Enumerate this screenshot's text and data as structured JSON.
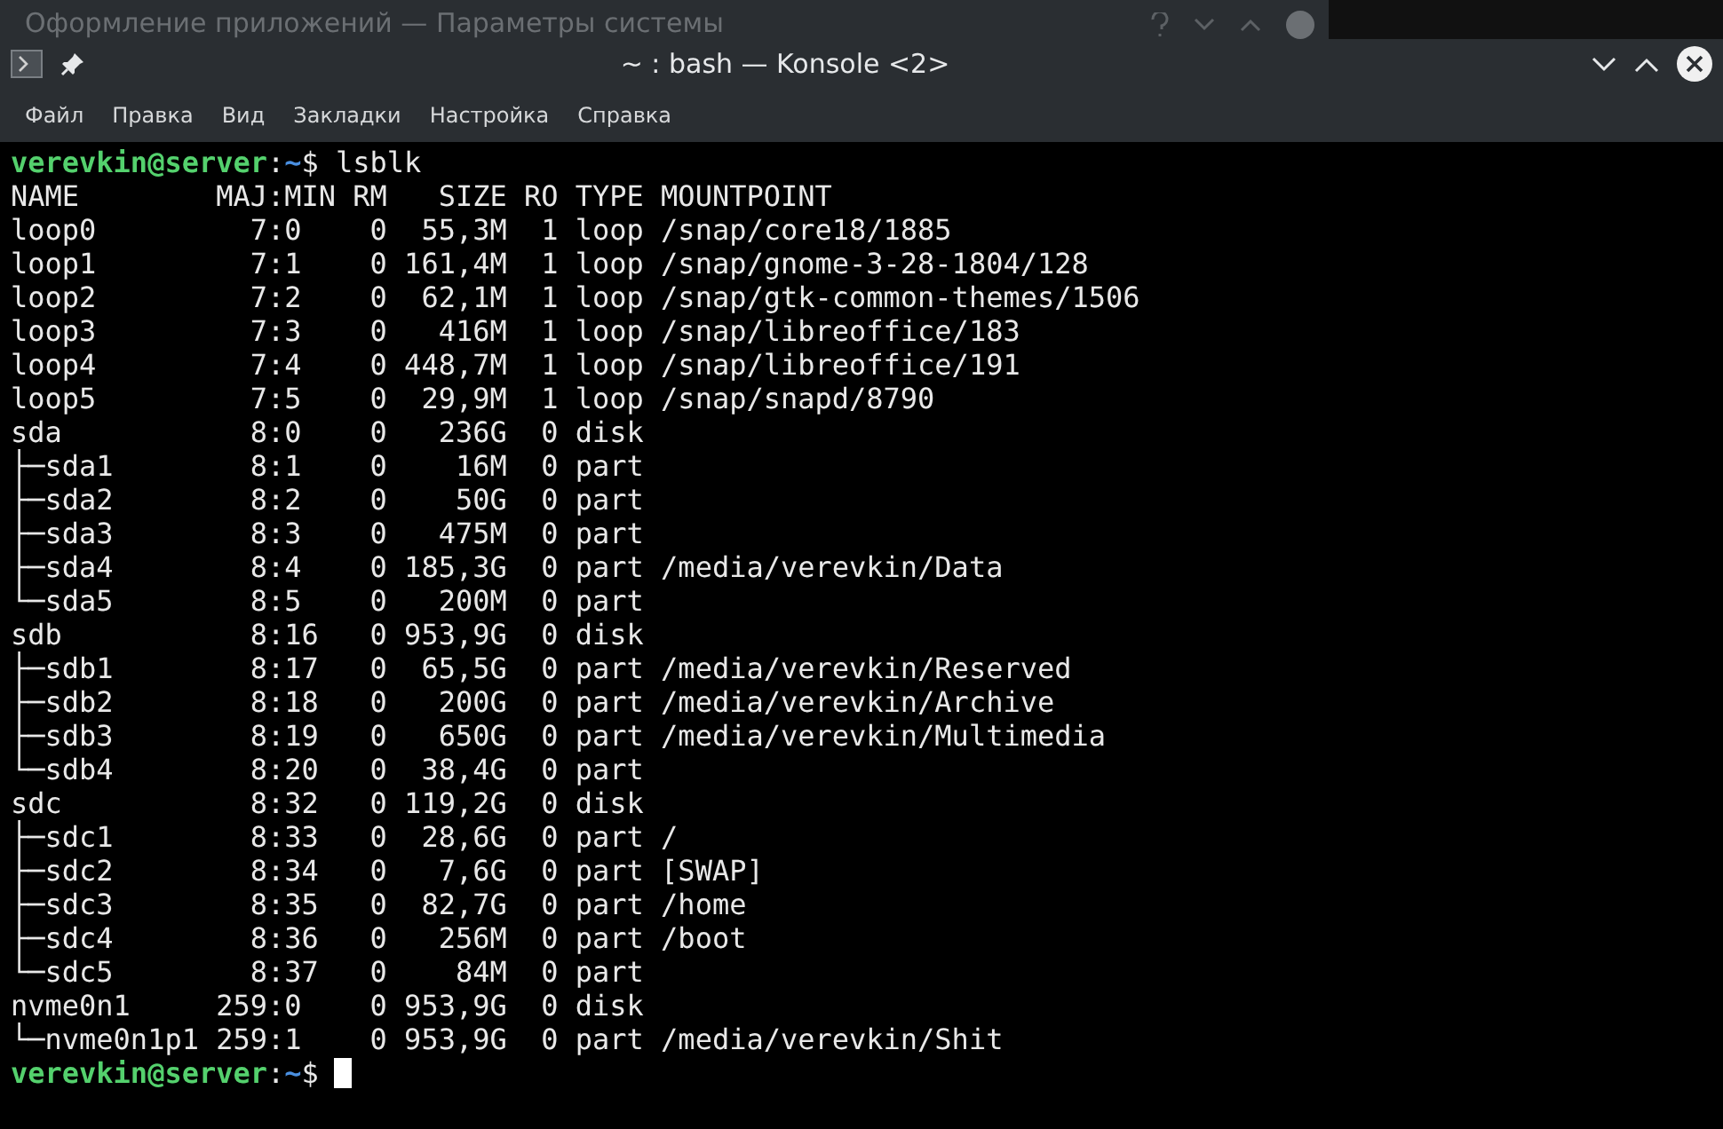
{
  "background_window": {
    "title": "Оформление приложений — Параметры системы"
  },
  "window": {
    "title": "~ : bash — Konsole <2>"
  },
  "menu": [
    "Файл",
    "Правка",
    "Вид",
    "Закладки",
    "Настройка",
    "Справка"
  ],
  "terminal": {
    "lines": [
      {
        "kind": "prompt",
        "user_host": "verevkin@server",
        "separator": ":",
        "path": "~",
        "symbol": "$",
        "command": "lsblk"
      },
      {
        "kind": "output",
        "text": "NAME        MAJ:MIN RM   SIZE RO TYPE MOUNTPOINT"
      },
      {
        "kind": "output",
        "text": "loop0         7:0    0  55,3M  1 loop /snap/core18/1885"
      },
      {
        "kind": "output",
        "text": "loop1         7:1    0 161,4M  1 loop /snap/gnome-3-28-1804/128"
      },
      {
        "kind": "output",
        "text": "loop2         7:2    0  62,1M  1 loop /snap/gtk-common-themes/1506"
      },
      {
        "kind": "output",
        "text": "loop3         7:3    0   416M  1 loop /snap/libreoffice/183"
      },
      {
        "kind": "output",
        "text": "loop4         7:4    0 448,7M  1 loop /snap/libreoffice/191"
      },
      {
        "kind": "output",
        "text": "loop5         7:5    0  29,9M  1 loop /snap/snapd/8790"
      },
      {
        "kind": "output",
        "text": "sda           8:0    0   236G  0 disk"
      },
      {
        "kind": "output",
        "text": "├─sda1        8:1    0    16M  0 part"
      },
      {
        "kind": "output",
        "text": "├─sda2        8:2    0    50G  0 part"
      },
      {
        "kind": "output",
        "text": "├─sda3        8:3    0   475M  0 part"
      },
      {
        "kind": "output",
        "text": "├─sda4        8:4    0 185,3G  0 part /media/verevkin/Data"
      },
      {
        "kind": "output",
        "text": "└─sda5        8:5    0   200M  0 part"
      },
      {
        "kind": "output",
        "text": "sdb           8:16   0 953,9G  0 disk"
      },
      {
        "kind": "output",
        "text": "├─sdb1        8:17   0  65,5G  0 part /media/verevkin/Reserved"
      },
      {
        "kind": "output",
        "text": "├─sdb2        8:18   0   200G  0 part /media/verevkin/Archive"
      },
      {
        "kind": "output",
        "text": "├─sdb3        8:19   0   650G  0 part /media/verevkin/Multimedia"
      },
      {
        "kind": "output",
        "text": "└─sdb4        8:20   0  38,4G  0 part"
      },
      {
        "kind": "output",
        "text": "sdc           8:32   0 119,2G  0 disk"
      },
      {
        "kind": "output",
        "text": "├─sdc1        8:33   0  28,6G  0 part /"
      },
      {
        "kind": "output",
        "text": "├─sdc2        8:34   0   7,6G  0 part [SWAP]"
      },
      {
        "kind": "output",
        "text": "├─sdc3        8:35   0  82,7G  0 part /home"
      },
      {
        "kind": "output",
        "text": "├─sdc4        8:36   0   256M  0 part /boot"
      },
      {
        "kind": "output",
        "text": "└─sdc5        8:37   0    84M  0 part"
      },
      {
        "kind": "output",
        "text": "nvme0n1     259:0    0 953,9G  0 disk"
      },
      {
        "kind": "output",
        "text": "└─nvme0n1p1 259:1    0 953,9G  0 part /media/verevkin/Shit"
      },
      {
        "kind": "prompt",
        "user_host": "verevkin@server",
        "separator": ":",
        "path": "~",
        "symbol": "$",
        "cursor": true
      }
    ]
  }
}
